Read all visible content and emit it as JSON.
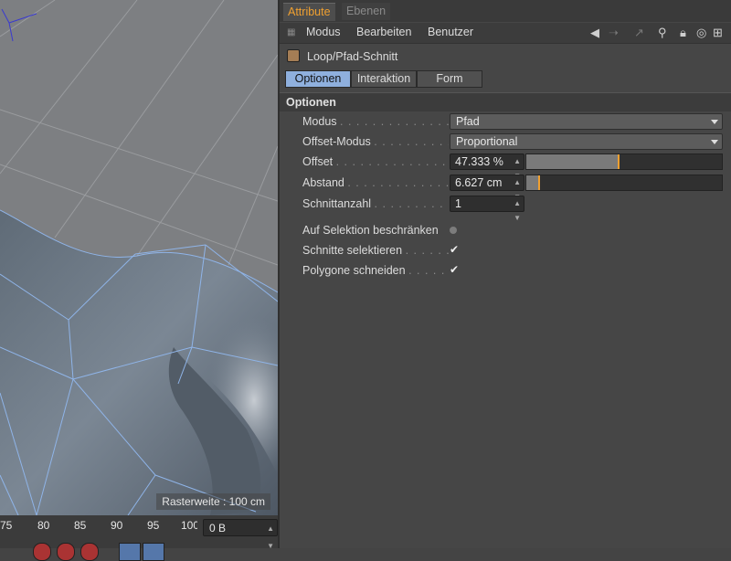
{
  "viewport": {
    "grid_label": "Rasterweite : 100 cm"
  },
  "timeline": {
    "ticks": [
      "75",
      "80",
      "85",
      "90",
      "95",
      "100"
    ],
    "frame_value": "0 B"
  },
  "panel": {
    "tabs": [
      {
        "label": "Attribute",
        "active": true
      },
      {
        "label": "Ebenen",
        "active": false
      }
    ],
    "menu": [
      "Modus",
      "Bearbeiten",
      "Benutzer"
    ],
    "object_title": "Loop/Pfad-Schnitt",
    "subtabs": [
      {
        "label": "Optionen",
        "active": true
      },
      {
        "label": "Interaktion",
        "active": false
      },
      {
        "label": "Form",
        "active": false
      }
    ],
    "section_title": "Optionen",
    "fields": {
      "modus": {
        "label": "Modus",
        "value": "Pfad"
      },
      "offset_modus": {
        "label": "Offset-Modus",
        "value": "Proportional"
      },
      "offset": {
        "label": "Offset",
        "value": "47.333 %",
        "slider": 0.4733
      },
      "abstand": {
        "label": "Abstand",
        "value": "6.627 cm",
        "slider": 0.066
      },
      "schnittanzahl": {
        "label": "Schnittanzahl",
        "value": "1"
      }
    },
    "options": [
      {
        "label": "Auf Selektion beschränken",
        "checked": false
      },
      {
        "label": "Schnitte selektieren",
        "checked": true
      },
      {
        "label": "Polygone schneiden",
        "checked": true
      }
    ],
    "check_glyph": "✔"
  },
  "colors": {
    "accent": "#f0a030",
    "active_subtab": "#8fb0de",
    "panel_bg": "#464646",
    "viewport_bg": "#7d7f82"
  }
}
